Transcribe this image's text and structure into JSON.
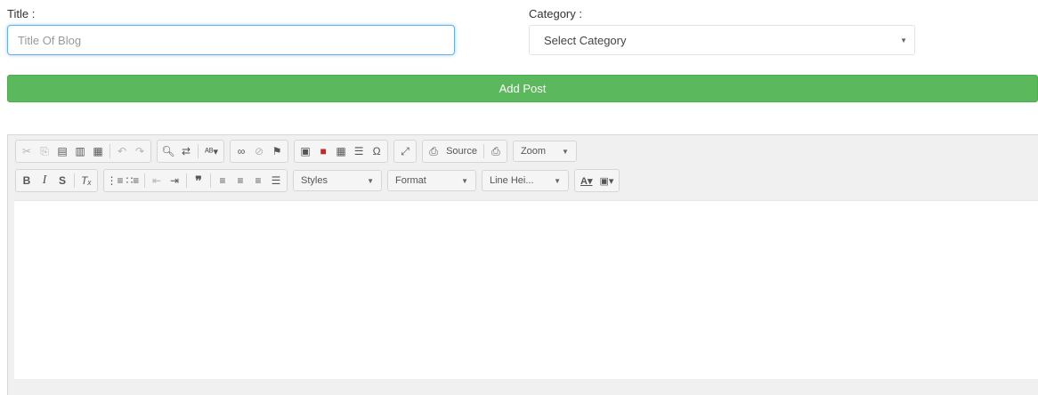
{
  "form": {
    "title_label": "Title :",
    "title_placeholder": "Title Of Blog",
    "title_value": "",
    "category_label": "Category :",
    "category_selected": "Select Category",
    "submit_label": "Add Post"
  },
  "editor": {
    "toolbar1": {
      "source_label": "Source",
      "zoom_label": "Zoom"
    },
    "toolbar2": {
      "bold": "B",
      "italic": "I",
      "strike": "S",
      "styles_label": "Styles",
      "format_label": "Format",
      "line_height_label": "Line Hei..."
    },
    "content": ""
  }
}
